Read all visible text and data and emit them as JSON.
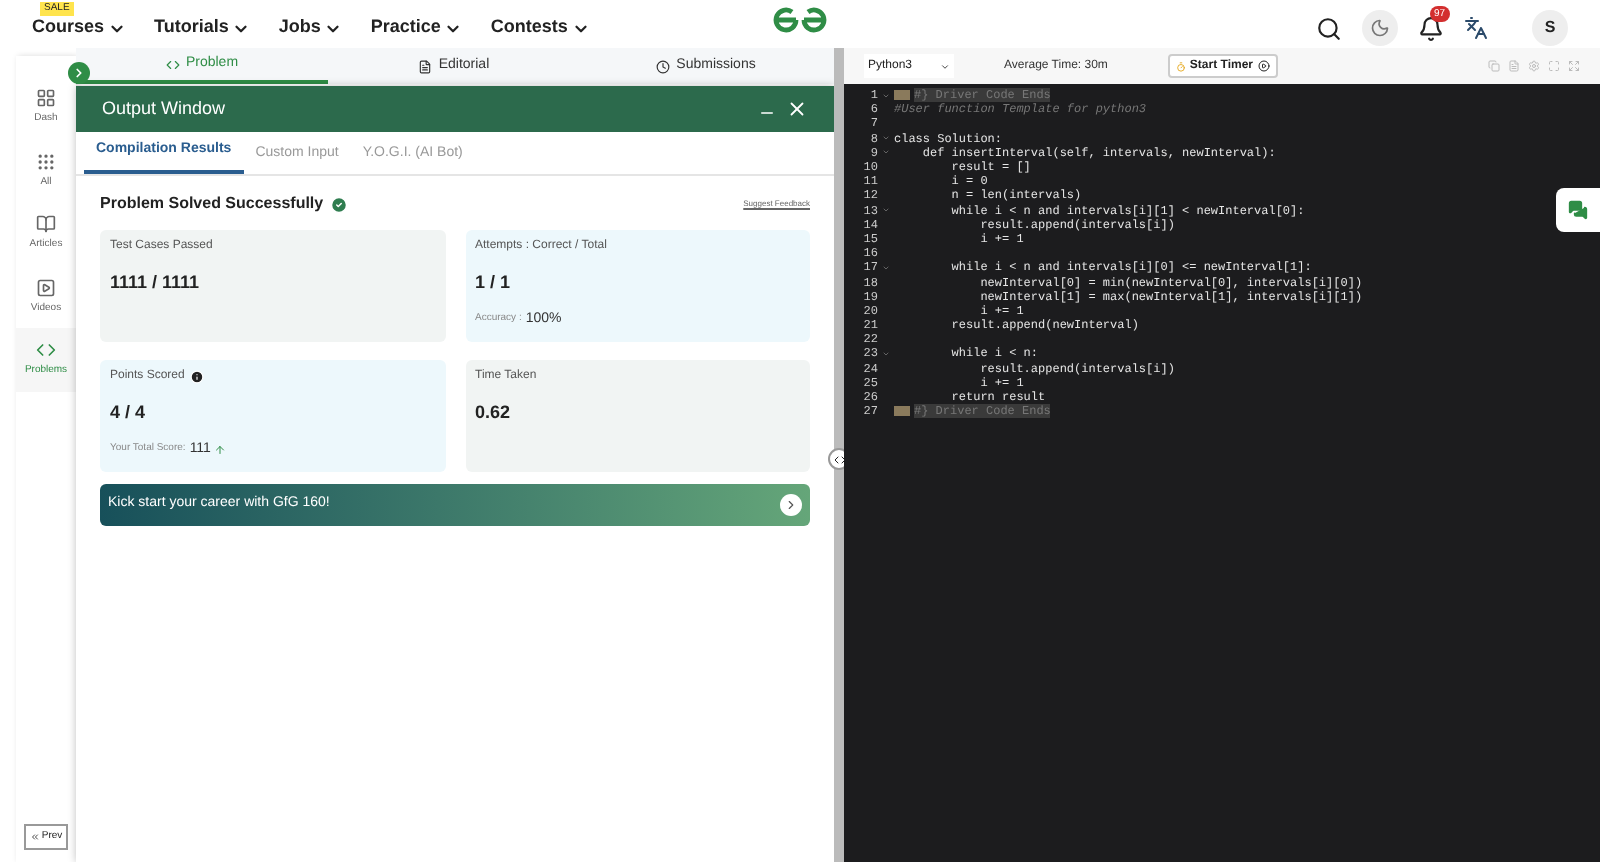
{
  "nav": {
    "items": [
      {
        "label": "Courses",
        "badge": "SALE"
      },
      {
        "label": "Tutorials"
      },
      {
        "label": "Jobs"
      },
      {
        "label": "Practice"
      },
      {
        "label": "Contests"
      }
    ],
    "notifications": "97",
    "avatar": "S"
  },
  "sidebar": {
    "items": [
      {
        "label": "Dash",
        "selected": false
      },
      {
        "label": "All",
        "selected": false
      },
      {
        "label": "Articles",
        "selected": false
      },
      {
        "label": "Videos",
        "selected": false
      },
      {
        "label": "Problems",
        "selected": true
      }
    ],
    "prev": "Prev"
  },
  "problem_tabs": [
    {
      "label": "Problem",
      "selected": true
    },
    {
      "label": "Editorial",
      "selected": false
    },
    {
      "label": "Submissions",
      "selected": false
    }
  ],
  "output_window": {
    "title": "Output Window",
    "tabs": [
      {
        "label": "Compilation Results",
        "selected": true
      },
      {
        "label": "Custom Input",
        "selected": false
      },
      {
        "label": "Y.O.G.I. (AI Bot)",
        "selected": false
      }
    ],
    "status": "Problem Solved Successfully",
    "feedback_link": "Suggest Feedback",
    "cards": [
      {
        "label": "Test Cases Passed",
        "value": "1111 / 1111",
        "color": "#f1f4f3"
      },
      {
        "label": "Attempts : Correct / Total",
        "value": "1 / 1",
        "note_label": "Accuracy :",
        "note_value": "100%",
        "color": "#edf8fc"
      },
      {
        "label": "Points Scored",
        "info": true,
        "value": "4 / 4",
        "note_label": "Your Total Score:",
        "note_value": "111",
        "trend_up": true,
        "color": "#edf8fc"
      },
      {
        "label": "Time Taken",
        "value": "0.62",
        "color": "#f1f4f3"
      }
    ],
    "banner": "Kick start your career with GfG 160!"
  },
  "editor": {
    "language": "Python3",
    "average_time": "Average Time: 30m",
    "timer_button": "Start Timer",
    "lines": [
      {
        "n": "1",
        "text": "#} Driver Code Ends",
        "folded": true,
        "foldable": true
      },
      {
        "n": "6",
        "text": "#User function Template for python3",
        "kind": "comment",
        "foldable": false
      },
      {
        "n": "7",
        "foldable": false
      },
      {
        "n": "8",
        "text": "class Solution:",
        "foldable": true
      },
      {
        "n": "9",
        "text": "    def insertInterval(self, intervals, newInterval):",
        "foldable": true
      },
      {
        "n": "10",
        "text": "        result = []",
        "foldable": false
      },
      {
        "n": "11",
        "text": "        i = 0",
        "foldable": false
      },
      {
        "n": "12",
        "text": "        n = len(intervals)",
        "foldable": false
      },
      {
        "n": "13",
        "text": "        while i < n and intervals[i][1] < newInterval[0]:",
        "foldable": true
      },
      {
        "n": "14",
        "text": "            result.append(intervals[i])",
        "foldable": false
      },
      {
        "n": "15",
        "text": "            i += 1",
        "foldable": false
      },
      {
        "n": "16",
        "foldable": false
      },
      {
        "n": "17",
        "text": "        while i < n and intervals[i][0] <= newInterval[1]:",
        "foldable": true
      },
      {
        "n": "18",
        "text": "            newInterval[0] = min(newInterval[0], intervals[i][0])",
        "foldable": false
      },
      {
        "n": "19",
        "text": "            newInterval[1] = max(newInterval[1], intervals[i][1])",
        "foldable": false
      },
      {
        "n": "20",
        "text": "            i += 1",
        "foldable": false
      },
      {
        "n": "21",
        "text": "        result.append(newInterval)",
        "foldable": false
      },
      {
        "n": "22",
        "foldable": false
      },
      {
        "n": "23",
        "text": "        while i < n:",
        "foldable": true
      },
      {
        "n": "24",
        "text": "            result.append(intervals[i])",
        "foldable": false
      },
      {
        "n": "25",
        "text": "            i += 1",
        "foldable": false
      },
      {
        "n": "26",
        "text": "        return result",
        "foldable": false
      },
      {
        "n": "27",
        "text": "#} Driver Code Ends",
        "folded": true,
        "foldable": false
      }
    ]
  }
}
